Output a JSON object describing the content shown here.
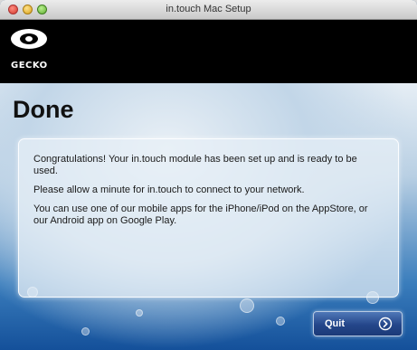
{
  "window": {
    "title": "in.touch Mac Setup"
  },
  "header": {
    "brand": "GECKO"
  },
  "page": {
    "title": "Done"
  },
  "message": {
    "paragraphs": [
      "Congratulations! Your in.touch module has been set up and is ready to be used.",
      "Please allow a minute for in.touch to connect to your network.",
      "You can use one of our mobile apps for the iPhone/iPod on the AppStore, or our Android app on Google Play."
    ]
  },
  "actions": {
    "quit_label": "Quit",
    "quit_icon": "arrow-right-circle-icon"
  },
  "colors": {
    "header_bg": "#000000",
    "button_bg": "#24468a"
  }
}
